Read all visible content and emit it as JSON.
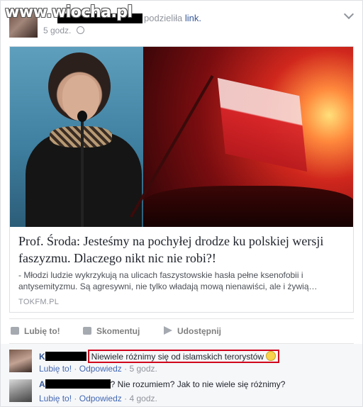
{
  "watermark": "www.wiocha.pl",
  "post": {
    "header_action": "podzieliła",
    "header_link": "link.",
    "time": "5 godz.",
    "link_card": {
      "title": "Prof. Środa: Jesteśmy na pochyłej drodze ku polskiej wersji faszyzmu. Dlaczego nikt nic nie robi?!",
      "description": "- Młodzi ludzie wykrzykują na ulicach faszystowskie hasła pełne ksenofobii i antysemityzmu. Są agresywni, nie tylko władają mową nienawiści, ale i żywią…",
      "source": "TOKFM.PL"
    }
  },
  "actions": {
    "like": "Lubię to!",
    "comment": "Skomentuj",
    "share": "Udostępnij"
  },
  "comments": [
    {
      "initial": "K",
      "text": "Niewiele różnimy się od islamskich terorystów",
      "like": "Lubię to!",
      "reply": "Odpowiedz",
      "time": "5 godz."
    },
    {
      "initial": "A",
      "text": "? Nie rozumiem? Jak to nie wiele się różnimy?",
      "like": "Lubię to!",
      "reply": "Odpowiedz",
      "time": "4 godz."
    }
  ],
  "colors": {
    "link_blue": "#365899",
    "highlight_red": "#d0021b"
  }
}
